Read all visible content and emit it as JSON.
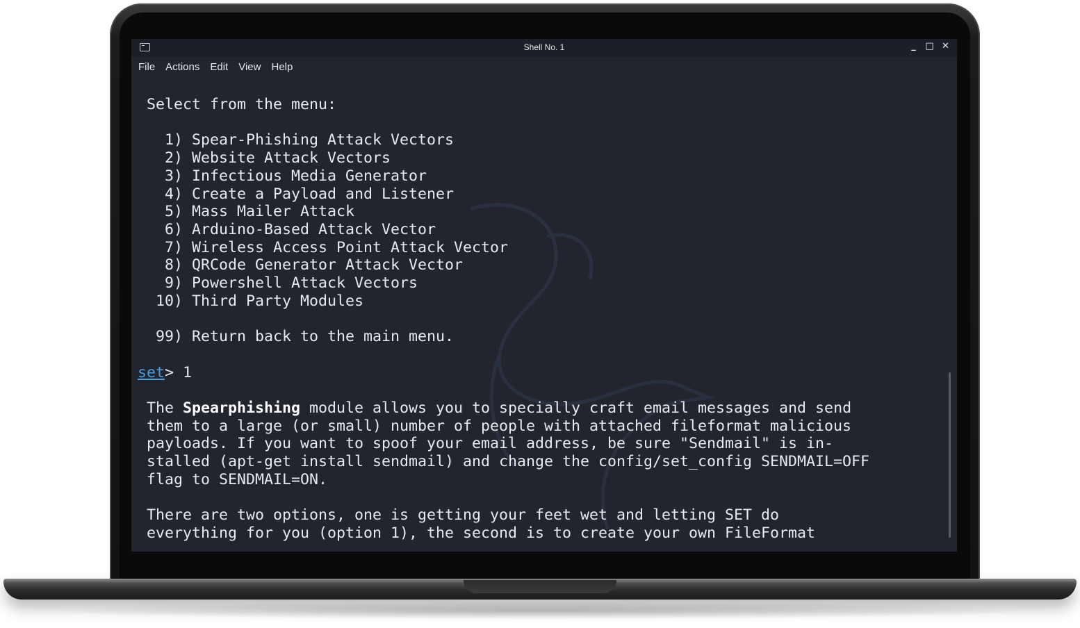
{
  "window": {
    "title": "Shell No. 1",
    "controls": {
      "minimize": "_",
      "maximize": "□",
      "close": "✕"
    }
  },
  "menu": {
    "items": [
      "File",
      "Actions",
      "Edit",
      "View",
      "Help"
    ]
  },
  "terminal": {
    "header": " Select from the menu:",
    "options": [
      "   1) Spear-Phishing Attack Vectors",
      "   2) Website Attack Vectors",
      "   3) Infectious Media Generator",
      "   4) Create a Payload and Listener",
      "   5) Mass Mailer Attack",
      "   6) Arduino-Based Attack Vector",
      "   7) Wireless Access Point Attack Vector",
      "   8) QRCode Generator Attack Vector",
      "   9) Powershell Attack Vectors",
      "  10) Third Party Modules"
    ],
    "return_option": "  99) Return back to the main menu.",
    "prompt": "set",
    "prompt_suffix": "> 1",
    "desc_prefix": " The ",
    "desc_bold": "Spearphishing",
    "desc_line1_rest": " module allows you to specially craft email messages and send",
    "desc_lines": [
      " them to a large (or small) number of people with attached fileformat malicious",
      " payloads. If you want to spoof your email address, be sure \"Sendmail\" is in-",
      " stalled (apt-get install sendmail) and change the config/set_config SENDMAIL=OFF",
      " flag to SENDMAIL=ON."
    ],
    "options_lines": [
      " There are two options, one is getting your feet wet and letting SET do",
      " everything for you (option 1), the second is to create your own FileFormat"
    ]
  },
  "colors": {
    "terminal_bg": "#23252e",
    "titlebar_bg": "#1d1f26",
    "text": "#e9eaee",
    "prompt": "#4b9fe0"
  },
  "icons": {
    "window_icon": "terminal-icon",
    "watermark": "kali-dragon-logo"
  }
}
